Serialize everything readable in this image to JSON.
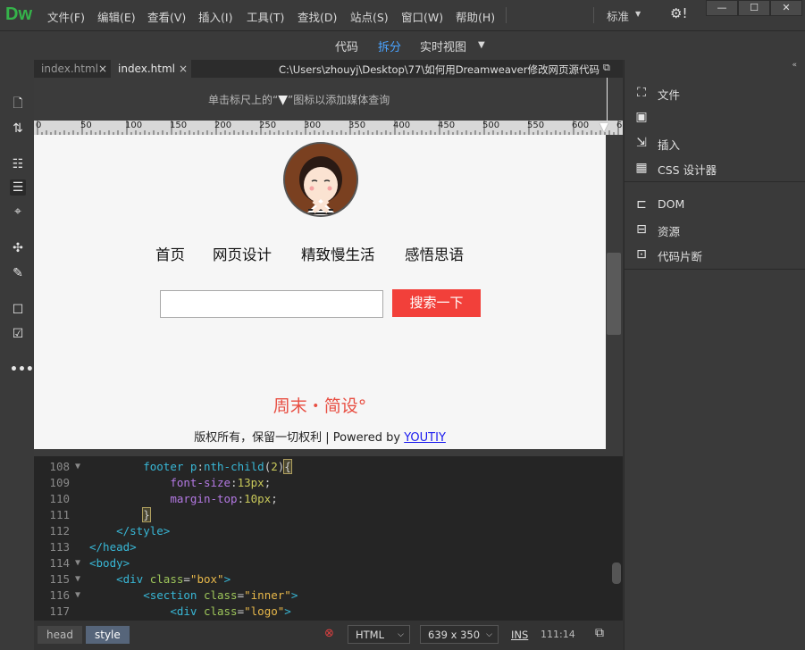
{
  "app": {
    "logo": "Dw"
  },
  "menubar": {
    "items": [
      "文件(F)",
      "编辑(E)",
      "查看(V)",
      "插入(I)",
      "工具(T)",
      "查找(D)",
      "站点(S)",
      "窗口(W)",
      "帮助(H)"
    ],
    "workspace": "标准",
    "window_buttons": [
      "—",
      "☐",
      "✕"
    ]
  },
  "viewbar": {
    "code": "代码",
    "split": "拆分",
    "live": "实时视图",
    "live_dropdown_icon": "caret-down-icon"
  },
  "tabs": [
    {
      "label": "index.html",
      "close": "×"
    },
    {
      "label": "index.html",
      "close": "×"
    }
  ],
  "file_path": "C:\\Users\\zhouyj\\Desktop\\77\\如何用Dreamweaver修改网页源代码\\index.html",
  "mq_hint": {
    "before": "单击标尺上的“",
    "after": "”图标以添加媒体查询"
  },
  "ruler": {
    "ticks": [
      "0",
      "50",
      "100",
      "150",
      "200",
      "250",
      "300",
      "350",
      "400",
      "450",
      "500",
      "550",
      "600",
      "6"
    ]
  },
  "live_view": {
    "nav": [
      "首页",
      "网页设计",
      "精致慢生活",
      "感悟思语"
    ],
    "search_button": "搜索一下",
    "search_value": "",
    "brand": "周末・简设°",
    "copyright_text": "版权所有，保留一切权利 | Powered by ",
    "copyright_link": "YOUTIY"
  },
  "code": {
    "lines": [
      {
        "n": "108",
        "fold": true,
        "indent": "        ",
        "parts": [
          [
            "sel",
            "footer p"
          ],
          [
            "pun",
            ":"
          ],
          [
            "sel",
            "nth-child"
          ],
          [
            "pun",
            "("
          ],
          [
            "num",
            "2"
          ],
          [
            "pun",
            ")"
          ],
          [
            "pun",
            "{"
          ]
        ]
      },
      {
        "n": "109",
        "fold": false,
        "indent": "            ",
        "parts": [
          [
            "prop",
            "font-size"
          ],
          [
            "pun",
            ":"
          ],
          [
            "num",
            "13px"
          ],
          [
            "pun",
            ";"
          ]
        ]
      },
      {
        "n": "110",
        "fold": false,
        "indent": "            ",
        "parts": [
          [
            "prop",
            "margin-top"
          ],
          [
            "pun",
            ":"
          ],
          [
            "num",
            "10px"
          ],
          [
            "pun",
            ";"
          ]
        ]
      },
      {
        "n": "111",
        "fold": false,
        "indent": "        ",
        "parts": [
          [
            "pun",
            "}"
          ]
        ]
      },
      {
        "n": "112",
        "fold": false,
        "indent": "    ",
        "parts": [
          [
            "tag",
            "</style>"
          ]
        ]
      },
      {
        "n": "113",
        "fold": false,
        "indent": "",
        "parts": [
          [
            "tag",
            "</head>"
          ]
        ]
      },
      {
        "n": "114",
        "fold": true,
        "indent": "",
        "parts": [
          [
            "tag",
            "<body>"
          ]
        ]
      },
      {
        "n": "115",
        "fold": true,
        "indent": "    ",
        "parts": [
          [
            "tag",
            "<div "
          ],
          [
            "attr",
            "class"
          ],
          [
            "pun",
            "="
          ],
          [
            "str",
            "\"box\""
          ],
          [
            "tag",
            ">"
          ]
        ]
      },
      {
        "n": "116",
        "fold": true,
        "indent": "        ",
        "parts": [
          [
            "tag",
            "<section "
          ],
          [
            "attr",
            "class"
          ],
          [
            "pun",
            "="
          ],
          [
            "str",
            "\"inner\""
          ],
          [
            "tag",
            ">"
          ]
        ]
      },
      {
        "n": "117",
        "fold": false,
        "indent": "            ",
        "parts": [
          [
            "tag",
            "<div "
          ],
          [
            "attr",
            "class"
          ],
          [
            "pun",
            "="
          ],
          [
            "str",
            "\"logo\""
          ],
          [
            "tag",
            ">"
          ]
        ]
      }
    ]
  },
  "status": {
    "crumbs": [
      "head",
      "style"
    ],
    "language": "HTML",
    "size": "639 x 350",
    "mode": "INS",
    "position": "111:14"
  },
  "right_panel": {
    "items": [
      "文件",
      "插入",
      "CSS 设计器",
      "DOM",
      "资源",
      "代码片断"
    ]
  }
}
